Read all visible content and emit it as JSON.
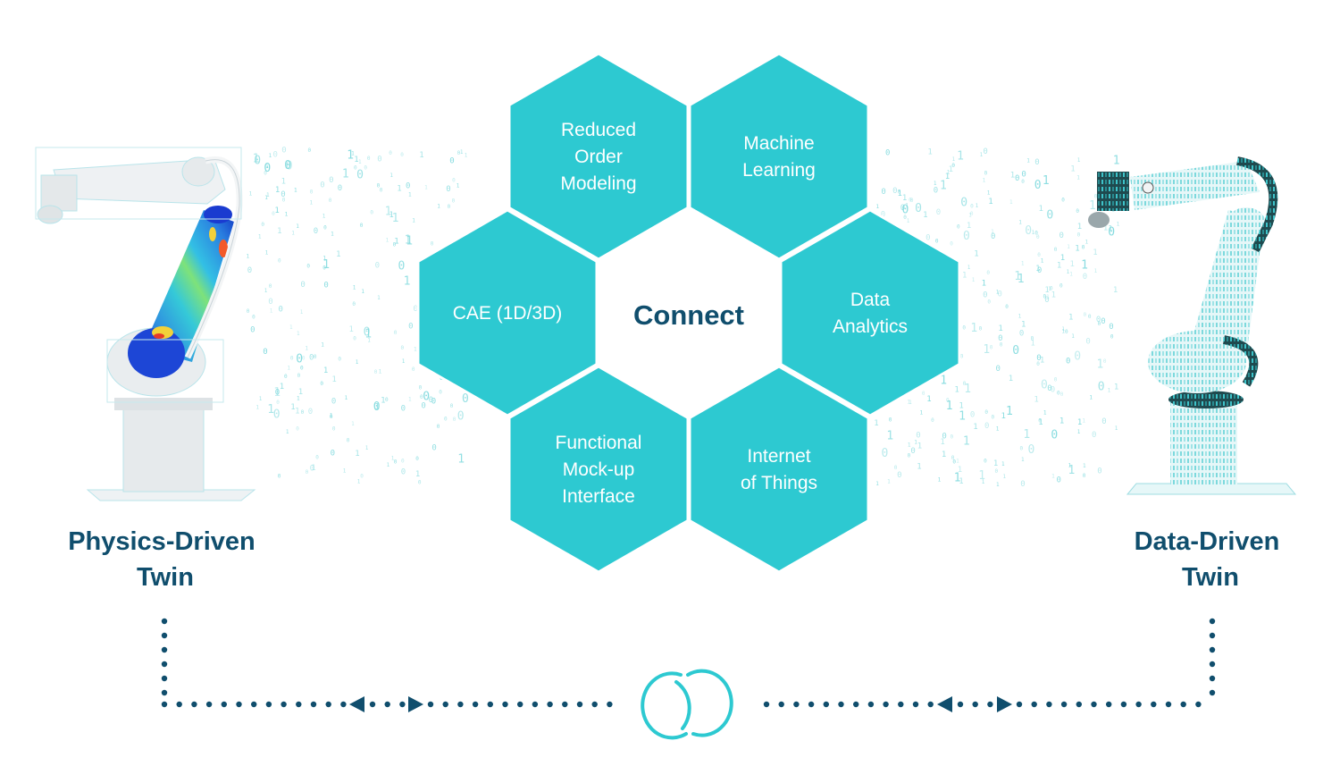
{
  "diagram": {
    "center": {
      "label": "Connect"
    },
    "hexagons": [
      {
        "id": "reduced-order-modeling",
        "lines": [
          "Reduced",
          "Order",
          "Modeling"
        ],
        "position": "top-left"
      },
      {
        "id": "machine-learning",
        "lines": [
          "Machine",
          "Learning"
        ],
        "position": "top-right"
      },
      {
        "id": "cae",
        "lines": [
          "CAE (1D/3D)"
        ],
        "position": "middle-left"
      },
      {
        "id": "data-analytics",
        "lines": [
          "Data",
          "Analytics"
        ],
        "position": "middle-right"
      },
      {
        "id": "functional-mockup-interface",
        "lines": [
          "Functional",
          "Mock-up",
          "Interface"
        ],
        "position": "bottom-left"
      },
      {
        "id": "internet-of-things",
        "lines": [
          "Internet",
          "of Things"
        ],
        "position": "bottom-right"
      }
    ],
    "left_twin": {
      "lines": [
        "Physics-Driven",
        "Twin"
      ],
      "image": "robot-arm-fea-stress-map"
    },
    "right_twin": {
      "lines": [
        "Data-Driven",
        "Twin"
      ],
      "image": "robot-arm-binary-texture"
    },
    "connector": {
      "icon": "interlocking-rings-icon",
      "arrows": "bidirectional"
    },
    "binary_glyphs": [
      "0",
      "1"
    ]
  },
  "colors": {
    "hex_fill": "#2dc9d1",
    "dark_teal": "#104e6d",
    "ring": "#2dc9d1",
    "binary": "#7dd9dd",
    "background": "#ffffff"
  }
}
